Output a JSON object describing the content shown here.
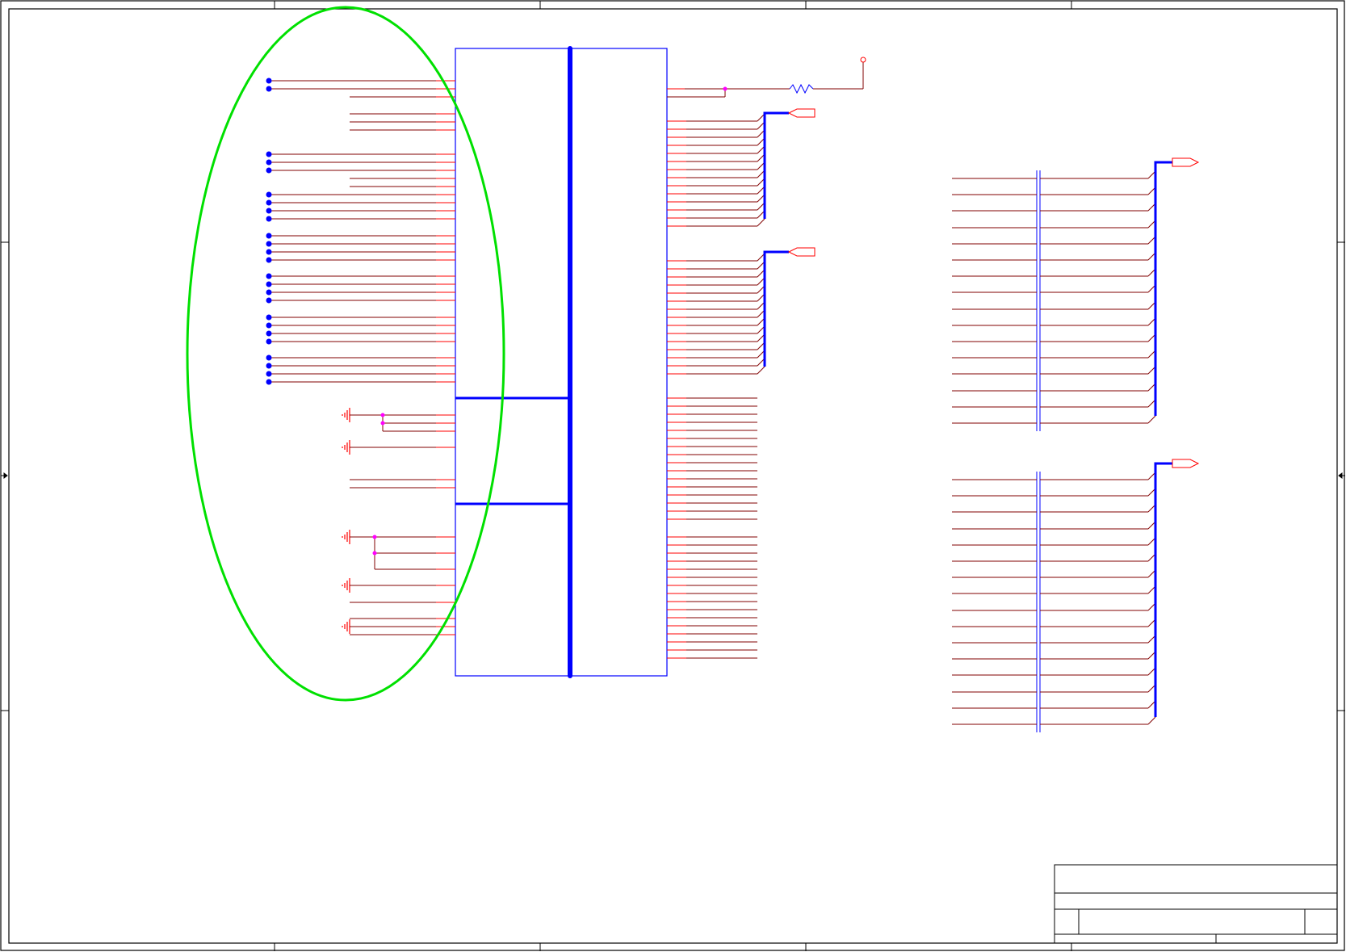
{
  "sheet": {
    "background": "#ffffff",
    "border_color": "#000000"
  },
  "colors": {
    "highlight_ellipse": "#00e000",
    "wire": "#800000",
    "pin": "#ff0000",
    "bus": "#0000ff",
    "component_outline": "#0000ff",
    "junction": "#ff00ff",
    "net_label": "#ff0000",
    "no_connect_dot": "#0000ff"
  },
  "title_block": {
    "title": "",
    "size": "",
    "document_number": "",
    "revision": "",
    "date": "",
    "sheet": ""
  },
  "components": {
    "main_ic": {
      "designator": "",
      "part_name": ""
    },
    "pullup_resistor": {
      "designator": "",
      "value": ""
    },
    "bus_port_top": {
      "label": ""
    },
    "bus_port_mid": {
      "label": ""
    },
    "right_bus_port_top": {
      "label": ""
    },
    "right_bus_port_bottom": {
      "label": ""
    }
  }
}
